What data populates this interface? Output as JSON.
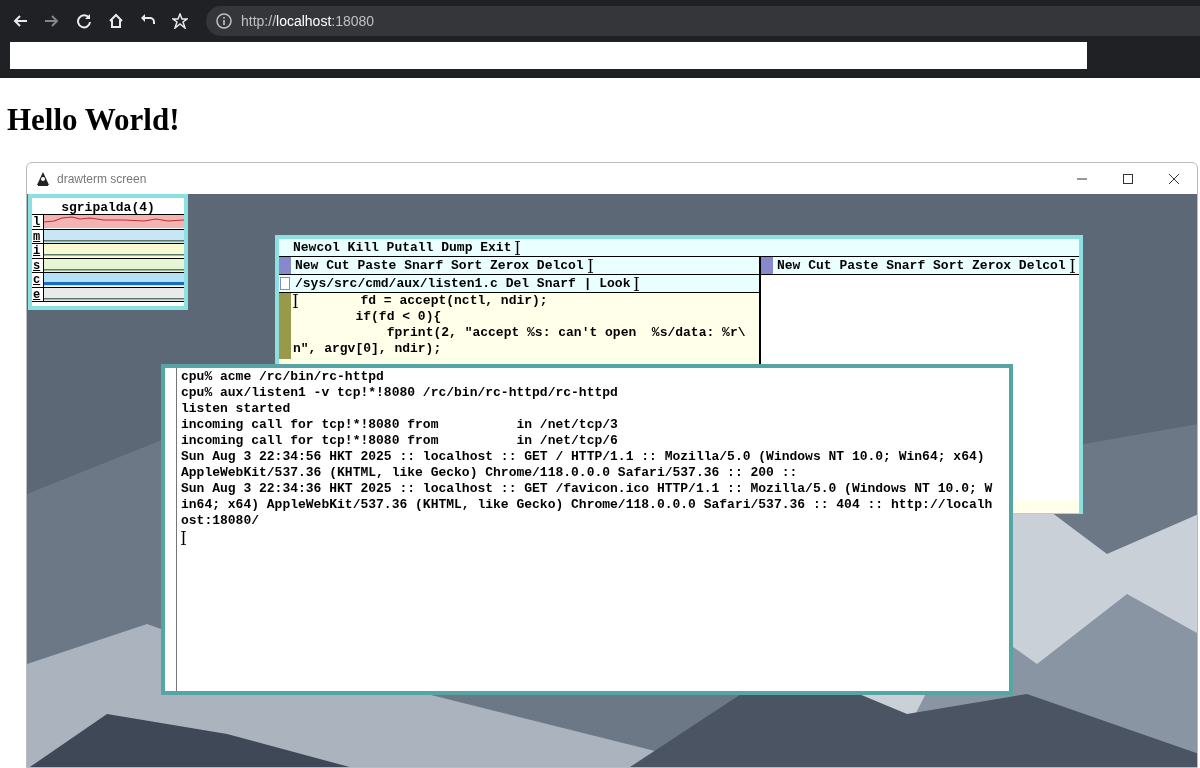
{
  "browser": {
    "nav_buttons": [
      {
        "kind": "back",
        "disabled": false
      },
      {
        "kind": "forward",
        "disabled": true
      },
      {
        "kind": "reload",
        "disabled": false
      },
      {
        "kind": "home",
        "disabled": false
      },
      {
        "kind": "undo",
        "disabled": false
      },
      {
        "kind": "star",
        "disabled": false
      }
    ],
    "address": {
      "scheme": "http://",
      "host": "localhost",
      "port": ":18080"
    }
  },
  "page": {
    "heading": "Hello World!"
  },
  "drawterm": {
    "title": "drawterm screen",
    "stats": {
      "title": "sgripalda(4)",
      "graphs": [
        {
          "label": "l",
          "kind": "wave",
          "color": "#f4b4b4"
        },
        {
          "label": "m",
          "kind": "flat",
          "color": "#c8e6f5"
        },
        {
          "label": "i",
          "kind": "flat",
          "color": "#fafad2"
        },
        {
          "label": "s",
          "kind": "flat",
          "color": "#e6f5d2"
        },
        {
          "label": "c",
          "kind": "bar",
          "color": "#b4e1f5"
        },
        {
          "label": "e",
          "kind": "flat",
          "color": "#eaeaea"
        }
      ]
    },
    "acme": {
      "main_tag": "Newcol Kill Putall Dump Exit",
      "columns": [
        {
          "tag": "New Cut Paste Snarf Sort Zerox Delcol",
          "windows": [
            {
              "tag": "/sys/src/cmd/aux/listen1.c Del Snarf | Look",
              "lines": [
                "\t\tfd = accept(nctl, ndir);",
                "\t\tif(fd < 0){",
                "\t\t\tfprint(2, \"accept %s: can't open  %s/data: %r\\",
                "n\", argv[0], ndir);"
              ]
            }
          ]
        },
        {
          "tag": "New Cut Paste Snarf Sort Zerox Delcol"
        }
      ]
    },
    "terminal": {
      "lines": [
        "cpu% acme /rc/bin/rc-httpd",
        "cpu% aux/listen1 -v tcp!*!8080 /rc/bin/rc-httpd/rc-httpd",
        "listen started",
        "incoming call for tcp!*!8080 from          in /net/tcp/3",
        "incoming call for tcp!*!8080 from          in /net/tcp/6",
        "Sun Aug 3 22:34:56 HKT 2025 :: localhost :: GET / HTTP/1.1 :: Mozilla/5.0 (Windows NT 10.0; Win64; x64)",
        "AppleWebKit/537.36 (KHTML, like Gecko) Chrome/118.0.0.0 Safari/537.36 :: 200 ::",
        "Sun Aug 3 22:34:36 HKT 2025 :: localhost :: GET /favicon.ico HTTP/1.1 :: Mozilla/5.0 (Windows NT 10.0; W",
        "in64; x64) AppleWebKit/537.36 (KHTML, like Gecko) Chrome/118.0.0.0 Safari/537.36 :: 404 :: http://localh",
        "ost:18080/"
      ]
    }
  }
}
